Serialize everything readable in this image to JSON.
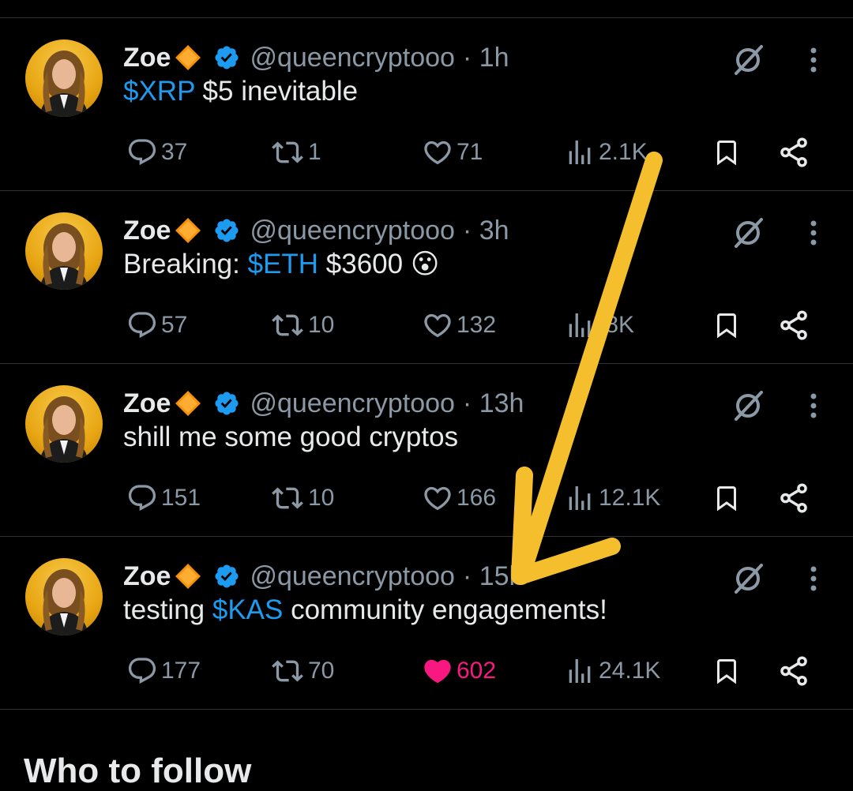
{
  "colors": {
    "background": "#000000",
    "text": "#e7e9ea",
    "muted": "#8b98a5",
    "link": "#1d9bf0",
    "like": "#f91880",
    "annotation_arrow": "#f4be2c"
  },
  "icons": {
    "reply": "reply-icon",
    "repost": "repost-icon",
    "like": "heart-icon",
    "views": "views-icon",
    "bookmark": "bookmark-icon",
    "share": "share-icon",
    "grok": "grok-icon",
    "more": "more-icon",
    "verified": "verified-badge-icon",
    "diamond": "orange-diamond-emoji"
  },
  "tweets": [
    {
      "name": "Zoe",
      "handle": "@queencryptooo",
      "time": "· 1h",
      "text": [
        {
          "t": "$XRP",
          "tag": true
        },
        {
          "t": " $5 inevitable",
          "tag": false
        }
      ],
      "replies": "37",
      "reposts": "1",
      "likes": "71",
      "views": "2.1K",
      "liked": false
    },
    {
      "name": "Zoe",
      "handle": "@queencryptooo",
      "time": "· 3h",
      "text": [
        {
          "t": "Breaking: ",
          "tag": false
        },
        {
          "t": "$ETH",
          "tag": true
        },
        {
          "t": " $3600 😮",
          "tag": false
        }
      ],
      "replies": "57",
      "reposts": "10",
      "likes": "132",
      "views": ".8K",
      "liked": false
    },
    {
      "name": "Zoe",
      "handle": "@queencryptooo",
      "time": "· 13h",
      "text": [
        {
          "t": "shill me some good cryptos",
          "tag": false
        }
      ],
      "replies": "151",
      "reposts": "10",
      "likes": "166",
      "views": "12.1K",
      "liked": false
    },
    {
      "name": "Zoe",
      "handle": "@queencryptooo",
      "time": "· 15h",
      "text": [
        {
          "t": "testing ",
          "tag": false
        },
        {
          "t": "$KAS",
          "tag": true
        },
        {
          "t": " community engagements!",
          "tag": false
        }
      ],
      "replies": "177",
      "reposts": "70",
      "likes": "602",
      "views": "24.1K",
      "liked": true
    }
  ],
  "section": {
    "title": "Who to follow"
  }
}
